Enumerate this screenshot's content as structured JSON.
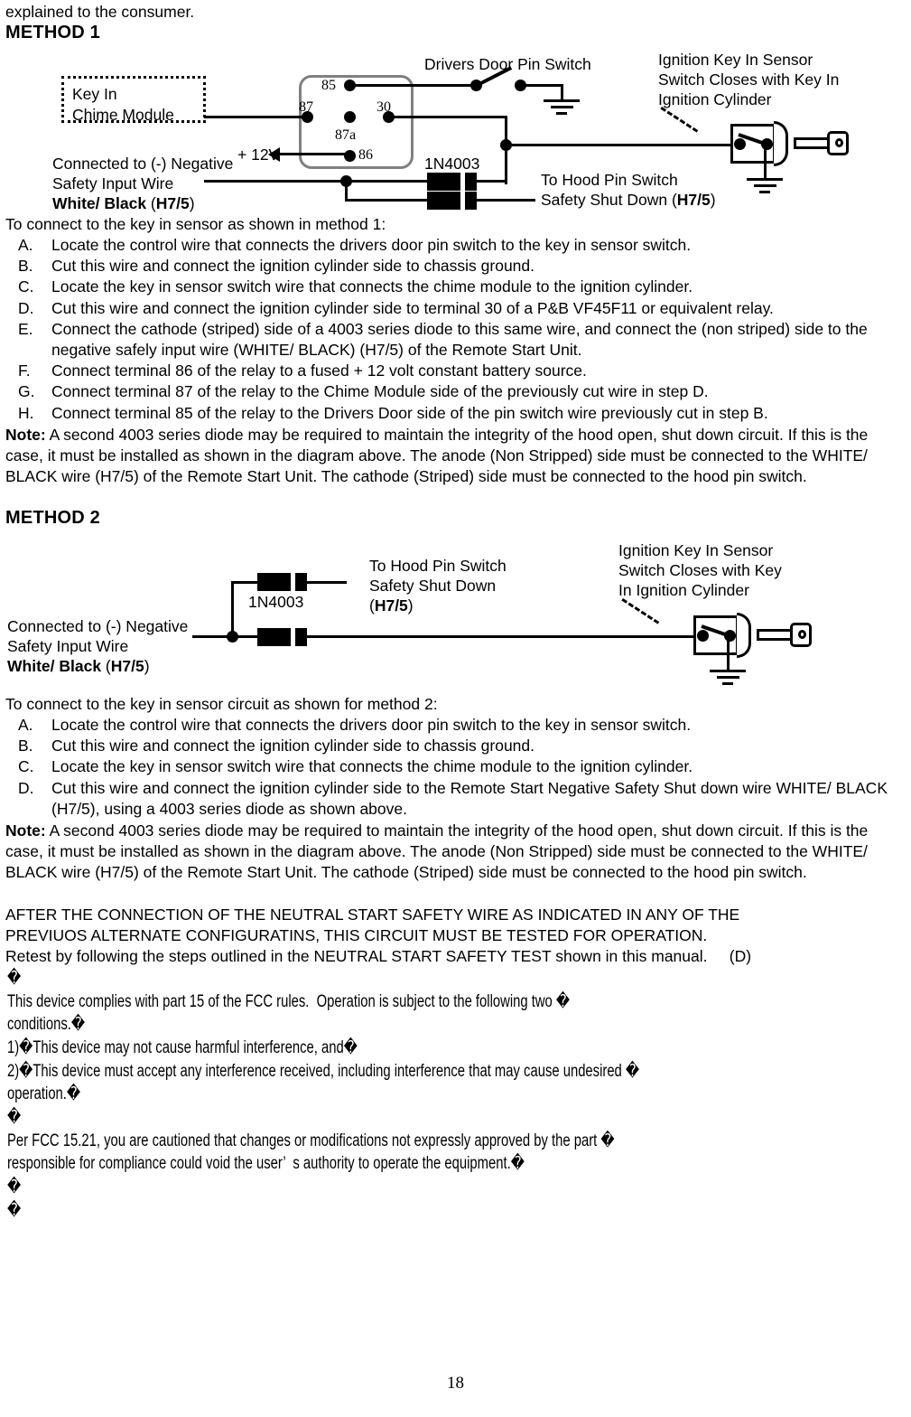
{
  "page": {
    "intro_line": "explained to the consumer.",
    "page_number": "18"
  },
  "method1": {
    "heading": "METHOD 1",
    "diagram": {
      "module_label_line1": "Key In",
      "module_label_line2": "Chime Module",
      "relay_pins": {
        "p85": "85",
        "p87": "87",
        "p30": "30",
        "p87a": "87a",
        "p86": "86"
      },
      "supply_label": "+ 12V",
      "door_switch_label": "Drivers Door Pin Switch",
      "ignition_label_line1": "Ignition Key In Sensor",
      "ignition_label_line2": "Switch Closes with Key In",
      "ignition_label_line3": "Ignition Cylinder",
      "diode_label": "1N4003",
      "hood_label_line1": "To Hood Pin Switch",
      "hood_label_line2_pre": "Safety Shut Down (",
      "hood_label_line2_bold": "H7/5",
      "hood_label_line2_post": ")",
      "negative_label_line1": "Connected to (-) Negative",
      "negative_label_line2": "Safety Input Wire",
      "negative_label_line3_bold": "White/ Black",
      "negative_label_line3_pre": " (",
      "negative_label_line3_h": "H7/5",
      "negative_label_line3_post": ")"
    },
    "intro": "To connect to the key in sensor as shown in method 1:",
    "steps": [
      {
        "marker": "A.",
        "text": "Locate the control wire that connects the drivers door pin switch to the key in sensor switch."
      },
      {
        "marker": "B.",
        "text": "Cut this wire and connect the ignition cylinder side to chassis ground."
      },
      {
        "marker": "C.",
        "text": "Locate the key in sensor switch wire that connects the chime module to the ignition cylinder."
      },
      {
        "marker": "D.",
        "text": "Cut this wire and connect the ignition cylinder side to terminal 30 of a P&B VF45F11 or equivalent relay."
      },
      {
        "marker": "E.",
        "text": "Connect the cathode (striped) side of a 4003 series diode to this same wire, and connect the (non striped) side to the negative safely input wire (WHITE/ BLACK) (H7/5) of the Remote Start Unit."
      },
      {
        "marker": "F.",
        "text": "Connect terminal 86 of the relay to a fused + 12 volt constant battery source."
      },
      {
        "marker": "G.",
        "text": "Connect terminal 87 of the relay to the Chime Module side of the previously cut wire in step D."
      },
      {
        "marker": "H.",
        "text": "Connect terminal 85 of the relay to the Drivers Door side of the pin switch wire previously cut in step B."
      }
    ],
    "note_label": "Note:",
    "note_text": " A second 4003 series diode may be required to maintain the integrity of the hood open, shut down circuit.    If this is the case, it must be installed as shown in the diagram above. The anode (Non Stripped) side must be connected to the WHITE/ BLACK wire (H7/5) of the Remote Start Unit. The cathode (Striped) side must be connected to the hood pin switch."
  },
  "method2": {
    "heading": "METHOD 2",
    "diagram": {
      "diode_label": "1N4003",
      "hood_label_line1": "To Hood Pin Switch",
      "hood_label_line2": "Safety Shut Down",
      "hood_label_line3_pre": "(",
      "hood_label_line3_bold": "H7/5",
      "hood_label_line3_post": ")",
      "ignition_label_line1": "Ignition Key In Sensor",
      "ignition_label_line2": "Switch Closes with Key",
      "ignition_label_line3": "In Ignition Cylinder",
      "negative_label_line1": "Connected to (-) Negative",
      "negative_label_line2": "Safety Input Wire",
      "negative_label_line3_bold": "White/ Black",
      "negative_label_line3_pre": " (",
      "negative_label_line3_h": "H7/5",
      "negative_label_line3_post": ")"
    },
    "intro": "To connect to the key in sensor circuit as shown for method 2:",
    "steps": [
      {
        "marker": "A.",
        "text": "Locate the control wire that connects the drivers door pin switch to the key in sensor switch."
      },
      {
        "marker": "B.",
        "text": "Cut this wire and connect the ignition cylinder side to chassis ground."
      },
      {
        "marker": "C.",
        "text": "Locate the key in sensor switch wire that connects the chime module to the ignition cylinder."
      },
      {
        "marker": "D.",
        "text": "Cut this wire and connect the ignition cylinder side to the Remote Start Negative Safety Shut down wire WHITE/ BLACK (H7/5), using a 4003 series diode as shown above."
      }
    ],
    "note_label": "Note:",
    "note_text": " A second 4003 series diode may be required to maintain the integrity of the hood open, shut down circuit.    If this is the case, it must be installed as shown in the diagram above. The anode (Non Stripped) side must be connected to the WHITE/ BLACK wire (H7/5) of the Remote Start Unit. The cathode (Striped) side must be connected to the hood pin switch.",
    "after_text_line1": "AFTER THE CONNECTION OF THE NEUTRAL START SAFETY WIRE AS INDICATED IN ANY OF THE",
    "after_text_line2": "PREVIUOS ALTERNATE CONFIGURATINS, THIS CIRCUIT MUST BE TESTED FOR OPERATION.",
    "after_text_line3": "Retest by following the steps outlined in the NEUTRAL START SAFETY TEST shown in this manual.     (D)"
  },
  "fcc": {
    "line_blank1": "�",
    "line1": "This device complies with part 15 of the FCC rules.  Operation is subject to the following two �",
    "line2": "conditions.�",
    "line3": "1)�This device may not cause harmful interference, and�",
    "line4": "2)�This device must accept any interference received, including interference that may cause undesired �",
    "line5": "operation.�",
    "line_blank2": "�",
    "line6": "Per FCC 15.21, you are cautioned that changes or modifications not expressly approved by the part �",
    "line7": "responsible for compliance could void the user’  s authority to operate the equipment.�",
    "line_blank3": "�",
    "line_blank4": "�"
  }
}
